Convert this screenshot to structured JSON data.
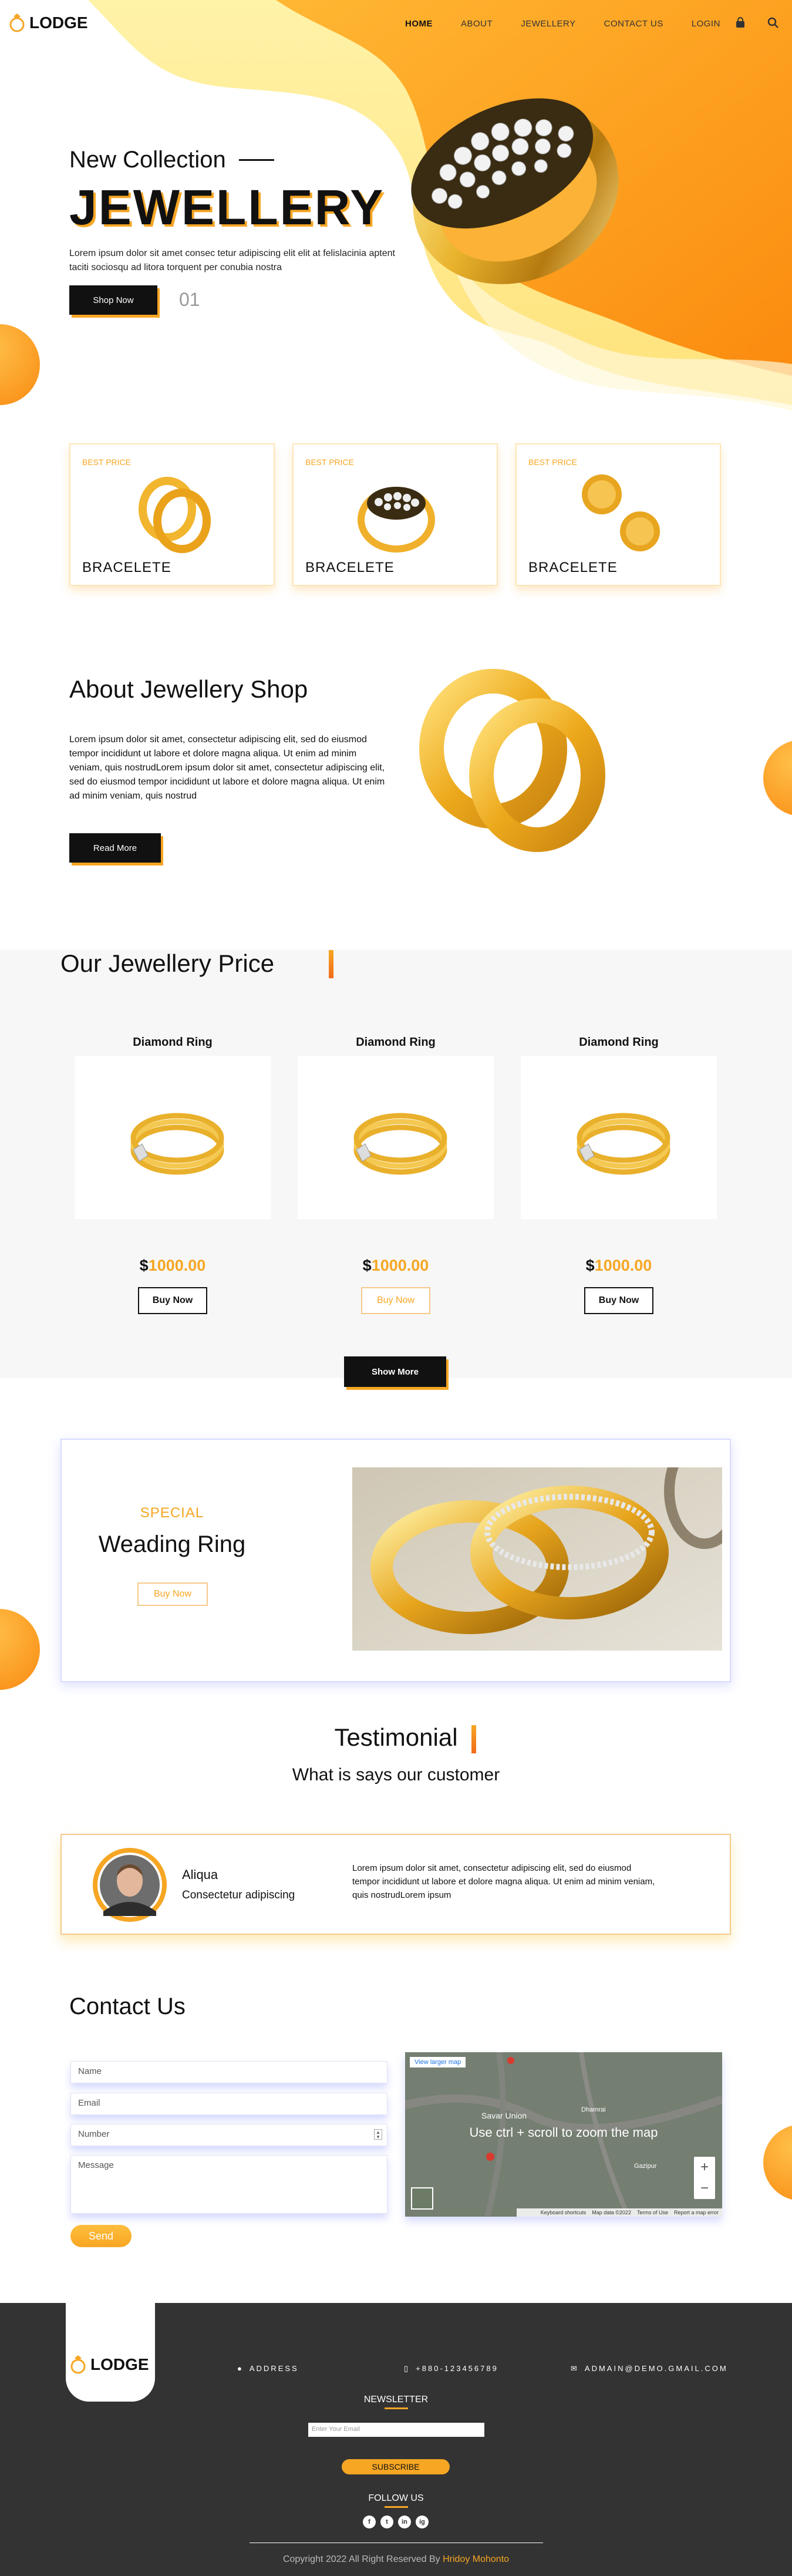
{
  "brand": {
    "name": "LODGE",
    "accent": "#f6a623",
    "dark": "#333333"
  },
  "nav": {
    "items": [
      "HOME",
      "ABOUT",
      "JEWELLERY",
      "CONTACT US",
      "LOGIN"
    ],
    "active": "HOME",
    "icons": [
      "bag-icon",
      "search-icon"
    ]
  },
  "hero": {
    "subtitle": "New Collection",
    "title": "JEWELLERY",
    "text": "Lorem ipsum dolor sit amet consec tetur adipiscing elit elit at felislacinia aptent taciti sociosqu ad litora torquent per conubia nostra",
    "button": "Shop Now",
    "slide_number": "01"
  },
  "categories": [
    {
      "badge": "BEST PRICE",
      "name": "BRACELETE"
    },
    {
      "badge": "BEST PRICE",
      "name": "BRACELETE"
    },
    {
      "badge": "BEST PRICE",
      "name": "BRACELETE"
    }
  ],
  "about": {
    "title": "About Jewellery Shop",
    "text": "Lorem ipsum dolor sit amet, consectetur adipiscing elit, sed do eiusmod tempor incididunt ut labore et dolore magna aliqua. Ut enim ad minim veniam, quis nostrudLorem ipsum dolor sit amet, consectetur adipiscing elit, sed do eiusmod tempor incididunt ut labore et dolore magna aliqua. Ut enim ad minim veniam, quis nostrud",
    "button": "Read More"
  },
  "price_section": {
    "title": "Our Jewellery Price",
    "products": [
      {
        "name": "Diamond Ring",
        "currency": "$",
        "price": "1000.00",
        "button": "Buy Now"
      },
      {
        "name": "Diamond Ring",
        "currency": "$",
        "price": "1000.00",
        "button": "Buy Now"
      },
      {
        "name": "Diamond Ring",
        "currency": "$",
        "price": "1000.00",
        "button": "Buy Now"
      }
    ],
    "show_more": "Show More"
  },
  "special": {
    "tag": "SPECIAL",
    "title": "Weading Ring",
    "button": "Buy Now"
  },
  "testimonial": {
    "title": "Testimonial",
    "subtitle": "What is says our customer",
    "name": "Aliqua",
    "role": "Consectetur adipiscing",
    "text": "Lorem ipsum dolor sit amet, consectetur adipiscing elit, sed do eiusmod tempor incididunt ut labore et dolore magna aliqua. Ut enim ad minim veniam, quis nostrudLorem ipsum"
  },
  "contact": {
    "title": "Contact Us",
    "placeholders": {
      "name": "Name",
      "email": "Email",
      "number": "Number",
      "message": "Message"
    },
    "send": "Send",
    "map": {
      "larger_link": "View larger map",
      "overlay": "Use ctrl + scroll to zoom the map",
      "labels": [
        "Savar Union",
        "Dhamrai",
        "Gazipur"
      ],
      "footer": [
        "Keyboard shortcuts",
        "Map data ©2022",
        "Terms of Use",
        "Report a map error"
      ]
    }
  },
  "footer": {
    "brand": "LODGE",
    "address": "ADDRESS",
    "phone": "+880-123456789",
    "email": "ADMAIN@DEMO.GMAIL.COM",
    "newsletter": "NEWSLETTER",
    "newsletter_placeholder": "Enter Your Email",
    "subscribe": "SUBSCRIBE",
    "follow": "FOLLOW US",
    "social": [
      "f",
      "t",
      "in",
      "ig"
    ],
    "copyright": "Copyright 2022 All Right Reserved By",
    "author": "Hridoy Mohonto"
  }
}
